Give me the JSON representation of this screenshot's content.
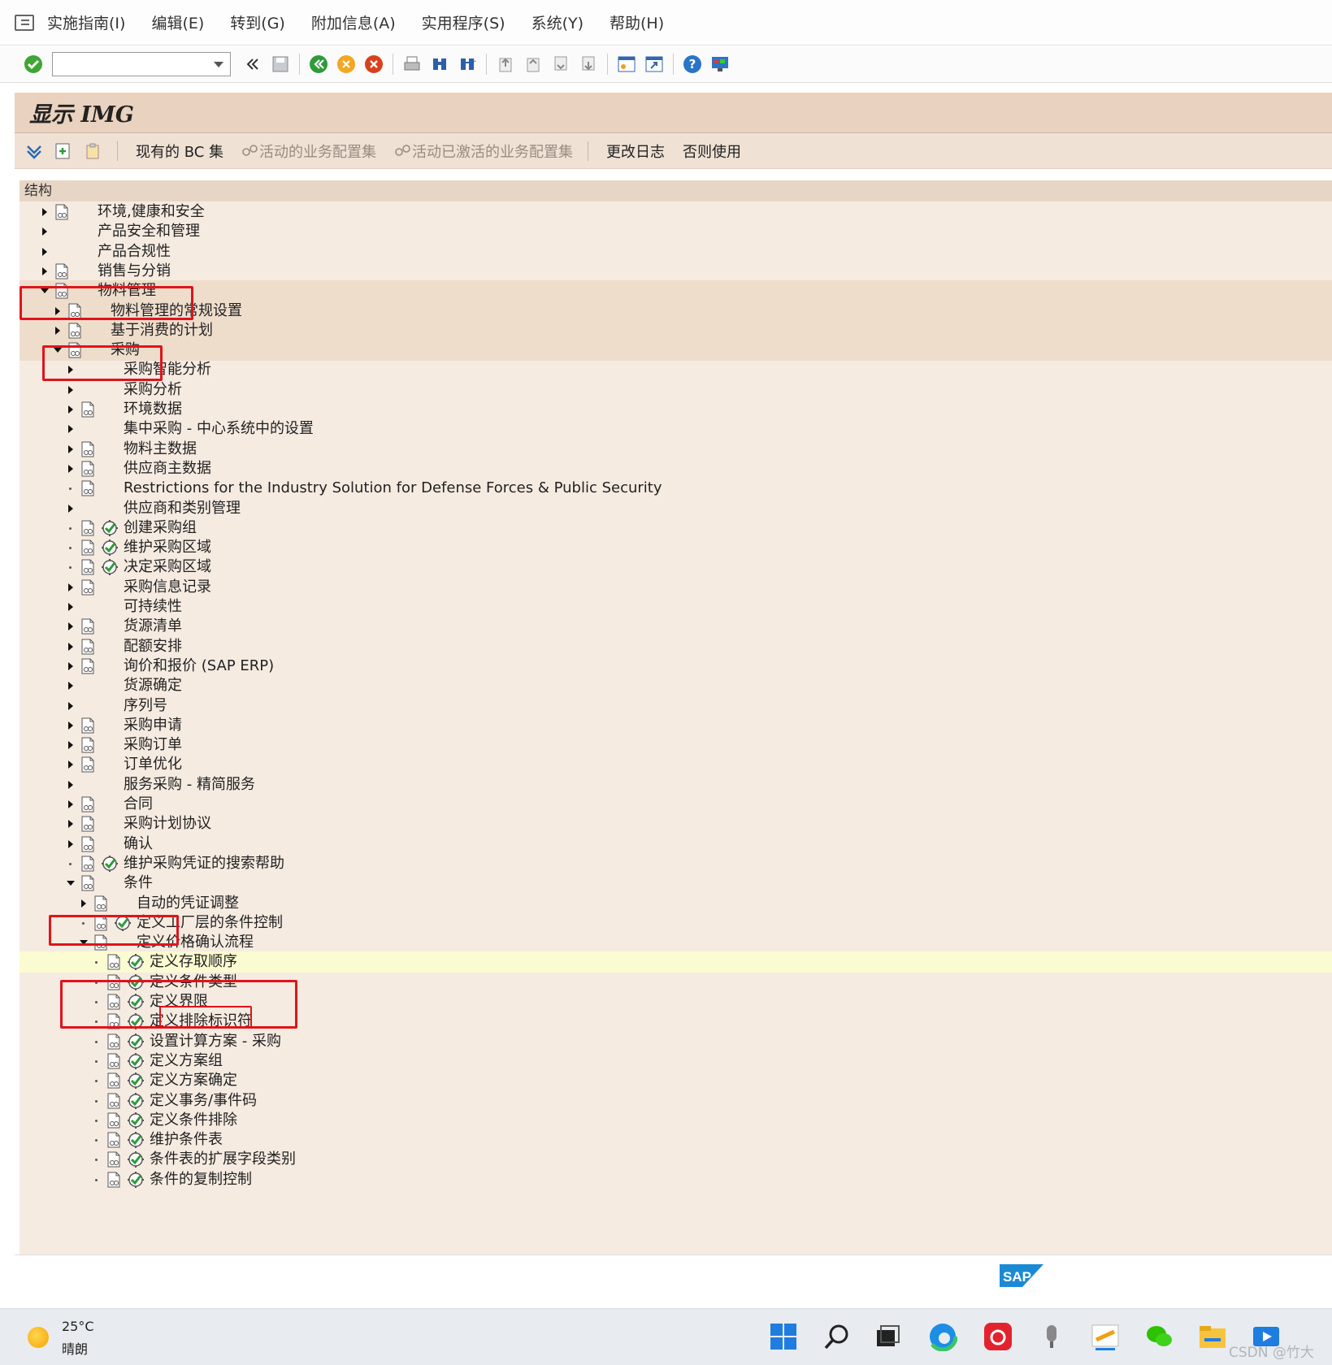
{
  "menubar": {
    "items": [
      "实施指南(I)",
      "编辑(E)",
      "转到(G)",
      "附加信息(A)",
      "实用程序(S)",
      "系统(Y)",
      "帮助(H)"
    ]
  },
  "toolbar": {
    "command_field_value": "",
    "icons": [
      "enter-icon",
      "back-double-icon",
      "save-icon",
      "back-icon",
      "exit-icon",
      "cancel-icon",
      "print-icon",
      "find-icon",
      "find-next-icon",
      "first-page-icon",
      "previous-page-icon",
      "next-page-icon",
      "last-page-icon",
      "new-session-icon",
      "shortcut-icon",
      "help-icon",
      "customize-layout-icon"
    ]
  },
  "title": "显示 IMG",
  "appbar": {
    "bc_sets": "现有的 BC 集",
    "active_bc_sets": "活动的业务配置集",
    "activated_bc_sets": "活动已激活的业务配置集",
    "change_log": "更改日志",
    "release_notes": "否则使用"
  },
  "structure_header": "结构",
  "tree": [
    {
      "label": "环境,健康和安全",
      "state": "collapsed",
      "doc": true,
      "act": false
    },
    {
      "label": "产品安全和管理",
      "state": "collapsed",
      "doc": false,
      "act": false
    },
    {
      "label": "产品合规性",
      "state": "collapsed",
      "doc": false,
      "act": false
    },
    {
      "label": "销售与分销",
      "state": "collapsed",
      "doc": true,
      "act": false
    },
    {
      "label": "物料管理",
      "state": "expanded",
      "doc": true,
      "act": false
    },
    {
      "label": "物料管理的常规设置",
      "state": "collapsed",
      "doc": true,
      "act": false
    },
    {
      "label": "基于消费的计划",
      "state": "collapsed",
      "doc": true,
      "act": false
    },
    {
      "label": "采购",
      "state": "expanded",
      "doc": true,
      "act": false
    },
    {
      "label": "采购智能分析",
      "state": "collapsed",
      "doc": false,
      "act": false
    },
    {
      "label": "采购分析",
      "state": "collapsed",
      "doc": false,
      "act": false
    },
    {
      "label": "环境数据",
      "state": "collapsed",
      "doc": true,
      "act": false
    },
    {
      "label": "集中采购 - 中心系统中的设置",
      "state": "collapsed",
      "doc": false,
      "act": false
    },
    {
      "label": "物料主数据",
      "state": "collapsed",
      "doc": true,
      "act": false
    },
    {
      "label": "供应商主数据",
      "state": "collapsed",
      "doc": true,
      "act": false
    },
    {
      "label": "Restrictions for the Industry Solution for Defense Forces & Public Security",
      "state": "leaf",
      "doc": true,
      "act": false
    },
    {
      "label": "供应商和类别管理",
      "state": "collapsed",
      "doc": false,
      "act": false
    },
    {
      "label": "创建采购组",
      "state": "leaf",
      "doc": true,
      "act": true
    },
    {
      "label": "维护采购区域",
      "state": "leaf",
      "doc": true,
      "act": true
    },
    {
      "label": "决定采购区域",
      "state": "leaf",
      "doc": true,
      "act": true
    },
    {
      "label": "采购信息记录",
      "state": "collapsed",
      "doc": true,
      "act": false
    },
    {
      "label": "可持续性",
      "state": "collapsed",
      "doc": false,
      "act": false
    },
    {
      "label": "货源清单",
      "state": "collapsed",
      "doc": true,
      "act": false
    },
    {
      "label": "配额安排",
      "state": "collapsed",
      "doc": true,
      "act": false
    },
    {
      "label": "询价和报价 (SAP ERP)",
      "state": "collapsed",
      "doc": true,
      "act": false
    },
    {
      "label": "货源确定",
      "state": "collapsed",
      "doc": false,
      "act": false
    },
    {
      "label": "序列号",
      "state": "collapsed",
      "doc": false,
      "act": false
    },
    {
      "label": "采购申请",
      "state": "collapsed",
      "doc": true,
      "act": false
    },
    {
      "label": "采购订单",
      "state": "collapsed",
      "doc": true,
      "act": false
    },
    {
      "label": "订单优化",
      "state": "collapsed",
      "doc": true,
      "act": false
    },
    {
      "label": "服务采购 - 精简服务",
      "state": "collapsed",
      "doc": false,
      "act": false
    },
    {
      "label": "合同",
      "state": "collapsed",
      "doc": true,
      "act": false
    },
    {
      "label": "采购计划协议",
      "state": "collapsed",
      "doc": true,
      "act": false
    },
    {
      "label": "确认",
      "state": "collapsed",
      "doc": true,
      "act": false
    },
    {
      "label": "维护采购凭证的搜索帮助",
      "state": "leaf",
      "doc": true,
      "act": true
    },
    {
      "label": "条件",
      "state": "expanded",
      "doc": true,
      "act": false
    },
    {
      "label": "自动的凭证调整",
      "state": "collapsed",
      "doc": true,
      "act": false
    },
    {
      "label": "定义工厂层的条件控制",
      "state": "leaf",
      "doc": true,
      "act": true
    },
    {
      "label": "定义价格确认流程",
      "state": "expanded",
      "doc": true,
      "act": false
    },
    {
      "label": "定义存取顺序",
      "state": "leaf",
      "doc": true,
      "act": true
    },
    {
      "label": "定义条件类型",
      "state": "leaf",
      "doc": true,
      "act": true
    },
    {
      "label": "定义界限",
      "state": "leaf",
      "doc": true,
      "act": true
    },
    {
      "label": "定义排除标识符",
      "state": "leaf",
      "doc": true,
      "act": true
    },
    {
      "label": "设置计算方案 - 采购",
      "state": "leaf",
      "doc": true,
      "act": true
    },
    {
      "label": "定义方案组",
      "state": "leaf",
      "doc": true,
      "act": true
    },
    {
      "label": "定义方案确定",
      "state": "leaf",
      "doc": true,
      "act": true
    },
    {
      "label": "定义事务/事件码",
      "state": "leaf",
      "doc": true,
      "act": true
    },
    {
      "label": "定义条件排除",
      "state": "leaf",
      "doc": true,
      "act": true
    },
    {
      "label": "维护条件表",
      "state": "leaf",
      "doc": true,
      "act": true
    },
    {
      "label": "条件表的扩展字段类别",
      "state": "leaf",
      "doc": true,
      "act": true
    },
    {
      "label": "条件的复制控制",
      "state": "leaf",
      "doc": true,
      "act": true
    }
  ],
  "footer": {
    "logo_text": "SAP"
  },
  "taskbar": {
    "temperature": "25°C",
    "weather": "晴朗",
    "apps": [
      "start-icon",
      "search-icon",
      "task-view-icon",
      "edge-browser-icon",
      "netease-music-icon",
      "microphone-app-icon",
      "sap-logon-icon",
      "wechat-icon",
      "file-explorer-icon",
      "media-player-icon"
    ]
  },
  "watermark": "CSDN @竹大"
}
